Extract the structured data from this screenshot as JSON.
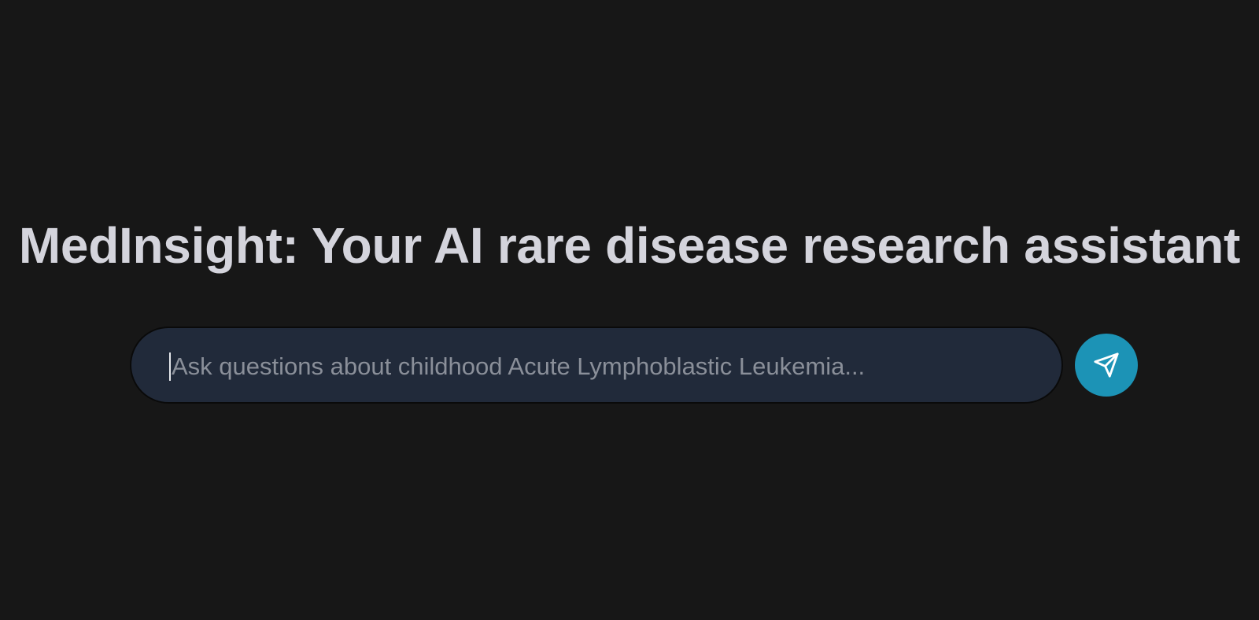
{
  "header": {
    "title": "MedInsight: Your AI rare disease research assistant"
  },
  "search": {
    "value": "",
    "placeholder": "Ask questions about childhood Acute Lymphoblastic Leukemia..."
  },
  "send_button": {
    "icon": "send-icon",
    "color": "#1c93b6"
  },
  "colors": {
    "background": "#171717",
    "input_background": "#212a3a",
    "title_text": "#d4d4dc"
  }
}
